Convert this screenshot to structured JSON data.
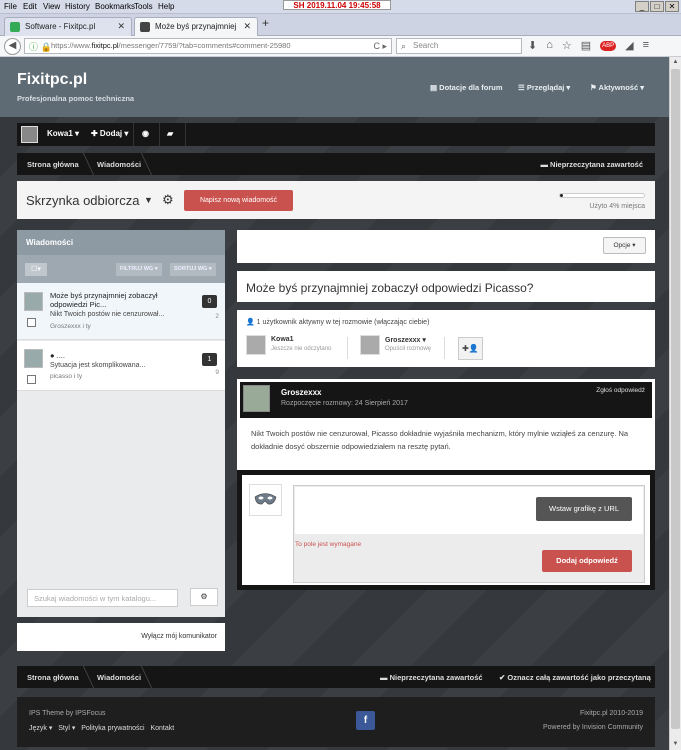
{
  "menubar": {
    "items": [
      "File",
      "Edit",
      "View",
      "History",
      "Bookmarks",
      "Tools",
      "Help"
    ],
    "clock": "SH  2019.11.04  19:45:58",
    "window_btns": [
      "_",
      "□",
      "✕"
    ]
  },
  "tabs": [
    {
      "label": "Software - Fixitpc.pl",
      "close": "✕"
    },
    {
      "label": "Może byś przynajmniej zobacz...",
      "close": "✕"
    }
  ],
  "new_tab": "+",
  "nav": {
    "url_prefix": "https://www.",
    "url_host": "fixitpc.pl",
    "url_rest": "/messenger/7759/?tab=comments#comment-25980",
    "search_placeholder": "Search"
  },
  "site": {
    "title": "Fixitpc.pl",
    "subtitle": "Profesjonalna pomoc techniczna",
    "nav": [
      "Dotacje dla forum",
      "Przeglądaj ▾",
      "Aktywność ▾"
    ]
  },
  "userbar": {
    "username": "Kowa1 ▾",
    "add": "✚ Dodaj ▾"
  },
  "breadcrumb": {
    "home": "Strona główna",
    "messages": "Wiadomości",
    "unread": "Nieprzeczytana zawartość"
  },
  "inbox": {
    "title": "Skrzynka odbiorcza",
    "compose": "Napisz nową wiadomość",
    "quota_fraction": 0.04,
    "quota_text": "Użyto 4% miejsca"
  },
  "left_panel": {
    "header": "Wiadomości",
    "filter": "FILTRUJ WG ▾",
    "sort": "SORTUJ WG ▾",
    "messages": [
      {
        "title": "Może byś przynajmniej zobaczył odpowiedzi Pic...",
        "snippet": "Nikt Twoich postów nie cenzurował...",
        "from": "Groszexxx i ty",
        "badge": "0",
        "count": "2"
      },
      {
        "title": "● ....",
        "snippet": "Sytuacja jest skomplikowana...",
        "from": "picasso i ty",
        "badge": "1",
        "count": "9"
      }
    ],
    "search_placeholder": "Szukaj wiadomości w tym katalogu...",
    "footer_link": "Wyłącz mój komunikator"
  },
  "conversation": {
    "options": "Opcje ▾",
    "title": "Może byś przynajmniej zobaczył odpowiedzi Picasso?",
    "active_users": "1 użytkownik aktywny w tej rozmowie (włączając ciebie)",
    "participants": [
      {
        "name": "Kowa1",
        "status": "Jeszcze nie odczytano"
      },
      {
        "name": "Groszexxx ▾",
        "status": "Opuścił rozmowę"
      }
    ],
    "post": {
      "author": "Groszexxx",
      "date": "Rozpoczęcie rozmowy: 24 Sierpień 2017",
      "report": "Zgłoś odpowiedź",
      "body": "Nikt Twoich postów nie cenzurował, Picasso dokładnie wyjaśniła mechanizm, który mylnie wziąłeś za cenzurę. Na dokładnie dosyć obszernie odpowiedziałem na resztę pytań."
    },
    "reply": {
      "embed_btn": "Wstaw grafikę z URL",
      "required": "To pole jest wymagane",
      "submit": "Dodaj odpowiedź"
    }
  },
  "bottom_crumbs": {
    "home": "Strona główna",
    "messages": "Wiadomości",
    "unread": "Nieprzeczytana zawartość",
    "mark_read": "✔  Oznacz całą zawartość jako przeczytaną"
  },
  "footer": {
    "theme": "IPS Theme by IPSFocus",
    "links": [
      "Język ▾",
      "Styl ▾",
      "Polityka prywatności",
      "Kontakt"
    ],
    "copyright": "Fixitpc.pl 2010-2019",
    "powered": "Powered by Invision Community",
    "fb": "f"
  },
  "colors": {
    "accent": "#c9524e",
    "dark": "#151515",
    "header": "#5e6b74"
  }
}
